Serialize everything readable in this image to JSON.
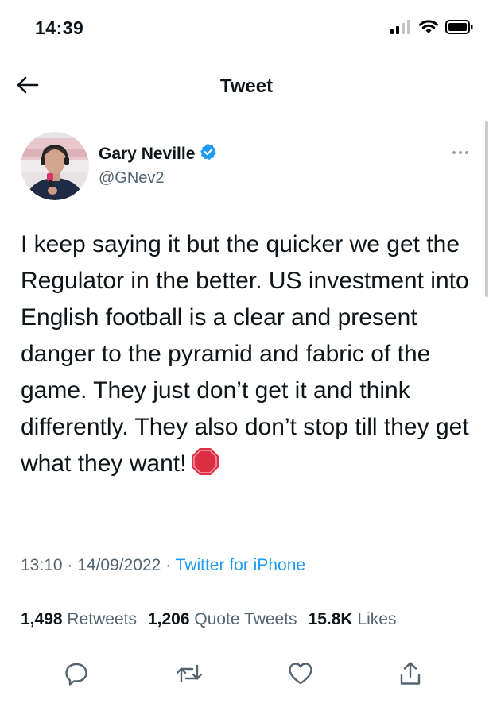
{
  "status_bar": {
    "time": "14:39",
    "icons": [
      "cellular-signal-icon",
      "wifi-icon",
      "battery-icon"
    ]
  },
  "nav": {
    "title": "Tweet",
    "back_icon": "back-arrow-icon"
  },
  "tweet": {
    "author": {
      "display_name": "Gary Neville",
      "handle": "@GNev2",
      "verified": true,
      "verified_color": "#1d9bf0"
    },
    "text": "I keep saying it but the quicker we get the Regulator in the better. US investment into English football is a clear and present danger to the pyramid and fabric of the game. They just don’t get it and think differently. They also don’t stop till they get what they want!",
    "emoji": "stop-sign-icon",
    "time": "13:10",
    "date": "14/09/2022",
    "source": "Twitter for iPhone",
    "stats": {
      "retweets_count": "1,498",
      "retweets_label": "Retweets",
      "quotes_count": "1,206",
      "quotes_label": "Quote Tweets",
      "likes_count": "15.8K",
      "likes_label": "Likes"
    },
    "actions": [
      "reply-icon",
      "retweet-icon",
      "like-icon",
      "share-icon"
    ]
  },
  "colors": {
    "accent": "#1d9bf0",
    "text_primary": "#0f1419",
    "text_secondary": "#536471",
    "divider": "#e6e9ec"
  }
}
